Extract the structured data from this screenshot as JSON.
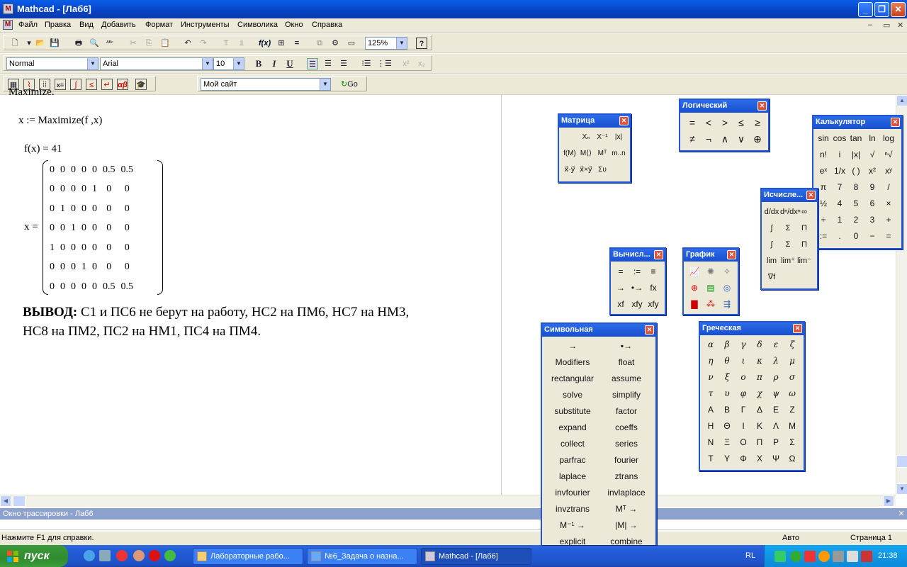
{
  "window": {
    "title": "Mathcad - [Лаб6]",
    "app_icon": "mathcad-icon"
  },
  "menu": [
    "Файл",
    "Правка",
    "Вид",
    "Добавить",
    "Формат",
    "Инструменты",
    "Символика",
    "Окно",
    "Справка"
  ],
  "toolbar": {
    "zoom": "125%",
    "style": "Normal",
    "font": "Arial",
    "size": "10",
    "bold": "B",
    "italic": "I",
    "underline": "U",
    "site": "Мой сайт",
    "go": "Go"
  },
  "doc": {
    "cut_top": "Maximize.",
    "assign": "x := Maximize(f ,x)",
    "fx": "f(x) = 41",
    "xlabel": "x =",
    "matrix": [
      [
        "0",
        "0",
        "0",
        "0",
        "0",
        "0.5",
        "0.5"
      ],
      [
        "0",
        "0",
        "0",
        "0",
        "1",
        "0",
        "0"
      ],
      [
        "0",
        "1",
        "0",
        "0",
        "0",
        "0",
        "0"
      ],
      [
        "0",
        "0",
        "1",
        "0",
        "0",
        "0",
        "0"
      ],
      [
        "1",
        "0",
        "0",
        "0",
        "0",
        "0",
        "0"
      ],
      [
        "0",
        "0",
        "0",
        "1",
        "0",
        "0",
        "0"
      ],
      [
        "0",
        "0",
        "0",
        "0",
        "0",
        "0.5",
        "0.5"
      ]
    ],
    "conclusion_label": "ВЫВОД:",
    "conclusion_line1": "С1 и ПС6 не берут на работу, НС2 на ПМ6, НС7 на НМ3,",
    "conclusion_line2": "НС8 на ПМ2, ПС2 на НМ1, ПС4 на ПМ4."
  },
  "palettes": {
    "matrix": {
      "title": "Матрица",
      "cells": [
        "",
        "Xₙ",
        "X⁻¹",
        "|x|",
        "f(M)",
        "M⟨⟩",
        "Mᵀ",
        "m..n",
        "x⃗·y⃗",
        "x⃗×y⃗",
        "Συ",
        ""
      ]
    },
    "logic": {
      "title": "Логический",
      "cells": [
        "=",
        "<",
        ">",
        "≤",
        "≥",
        "≠",
        "¬",
        "∧",
        "∨",
        "⊕"
      ]
    },
    "calc": {
      "title": "Калькулятор",
      "cells": [
        "sin",
        "cos",
        "tan",
        "ln",
        "log",
        "n!",
        "i",
        "|x|",
        "√",
        "ⁿ√",
        "eˣ",
        "1/x",
        "( )",
        "x²",
        "xʸ",
        "π",
        "7",
        "8",
        "9",
        "/",
        "½",
        "4",
        "5",
        "6",
        "×",
        "÷",
        "1",
        "2",
        "3",
        "+",
        ":=",
        ".",
        "0",
        "−",
        "="
      ]
    },
    "calculus": {
      "title": "Исчисле...",
      "cells": [
        "d/dx",
        "dⁿ/dxⁿ",
        "∞",
        "∫",
        "Σ",
        "Π",
        "∫",
        "Σ",
        "Π",
        "lim",
        "lim⁺",
        "lim⁻",
        "∇f"
      ]
    },
    "evaluate": {
      "title": "Вычисл...",
      "cells": [
        "=",
        ":=",
        "≡",
        "→",
        "•→",
        "fx",
        "xf",
        "xfy",
        "xfy"
      ]
    },
    "graph": {
      "title": "График",
      "cells": [
        "",
        "",
        "",
        "",
        "",
        "",
        "",
        "",
        ""
      ]
    },
    "symbolic": {
      "title": "Символьная",
      "cells": [
        "→",
        "▪→",
        "Modifiers",
        "float",
        "rectangular",
        "assume",
        "solve",
        "simplify",
        "substitute",
        "factor",
        "expand",
        "coeffs",
        "collect",
        "series",
        "parfrac",
        "fourier",
        "laplace",
        "ztrans",
        "invfourier",
        "invlaplace",
        "invztrans",
        "Mᵀ →",
        "M⁻¹ →",
        "|M| →",
        "explicit",
        "combine"
      ]
    },
    "greek": {
      "title": "Греческая",
      "lower": [
        "α",
        "β",
        "γ",
        "δ",
        "ε",
        "ζ",
        "η",
        "θ",
        "ι",
        "κ",
        "λ",
        "μ",
        "ν",
        "ξ",
        "ο",
        "π",
        "ρ",
        "σ",
        "τ",
        "υ",
        "φ",
        "χ",
        "ψ",
        "ω"
      ],
      "upper": [
        "Α",
        "Β",
        "Γ",
        "Δ",
        "Ε",
        "Ζ",
        "Η",
        "Θ",
        "Ι",
        "Κ",
        "Λ",
        "Μ",
        "Ν",
        "Ξ",
        "Ο",
        "Π",
        "Ρ",
        "Σ",
        "Τ",
        "Υ",
        "Φ",
        "Χ",
        "Ψ",
        "Ω"
      ]
    }
  },
  "trace": {
    "title": "Окно трассировки - Лаб6"
  },
  "status": {
    "help": "Нажмите F1 для справки.",
    "mode": "Авто",
    "page": "Страница 1"
  },
  "taskbar": {
    "start": "пуск",
    "tasks": [
      "Лабораторные рабо...",
      "№6_Задача о назна...",
      "Mathcad - [Лаб6]"
    ],
    "lang": "RL",
    "time": "21:38"
  },
  "colors": {
    "titlebar": "#0a5ee8",
    "taskbar": "#245edb",
    "start": "#3c9a3c",
    "palette_border": "#2456d4"
  }
}
